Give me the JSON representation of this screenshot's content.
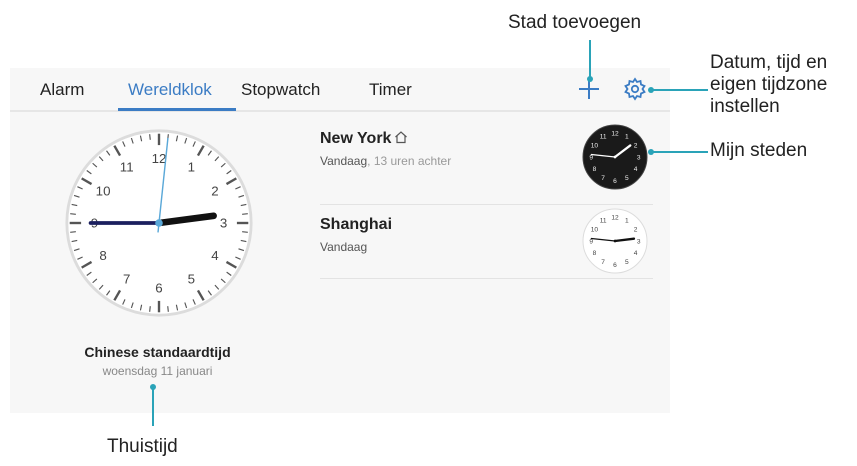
{
  "tabs": [
    {
      "label": "Alarm",
      "active": false
    },
    {
      "label": "Wereldklok",
      "active": true
    },
    {
      "label": "Stopwatch",
      "active": false
    },
    {
      "label": "Timer",
      "active": false
    }
  ],
  "toolbar": {
    "add_icon": "plus-icon",
    "settings_icon": "gear-icon"
  },
  "home_clock": {
    "city": "Chinese standaardtijd",
    "date": "woensdag 11 januari",
    "time": "14:46",
    "numerals": [
      "12",
      "1",
      "2",
      "3",
      "4",
      "5",
      "6",
      "7",
      "8",
      "9",
      "10",
      "11"
    ]
  },
  "cities": [
    {
      "name": "New York",
      "day": "Vandaag",
      "offset": ", 13 uren achter",
      "is_home_marked": true,
      "dial": "dark"
    },
    {
      "name": "Shanghai",
      "day": "Vandaag",
      "offset": "",
      "is_home_marked": false,
      "dial": "light"
    }
  ],
  "annotations": {
    "add_city": "Stad toevoegen",
    "settings_line1": "Datum, tijd en",
    "settings_line2": "eigen tijdzone",
    "settings_line3": "instellen",
    "my_cities": "Mijn steden",
    "home_time": "Thuistijd"
  },
  "colors": {
    "accent": "#3b7cc4",
    "callout": "#2aa3b8",
    "second_hand": "#5aa8d8"
  }
}
